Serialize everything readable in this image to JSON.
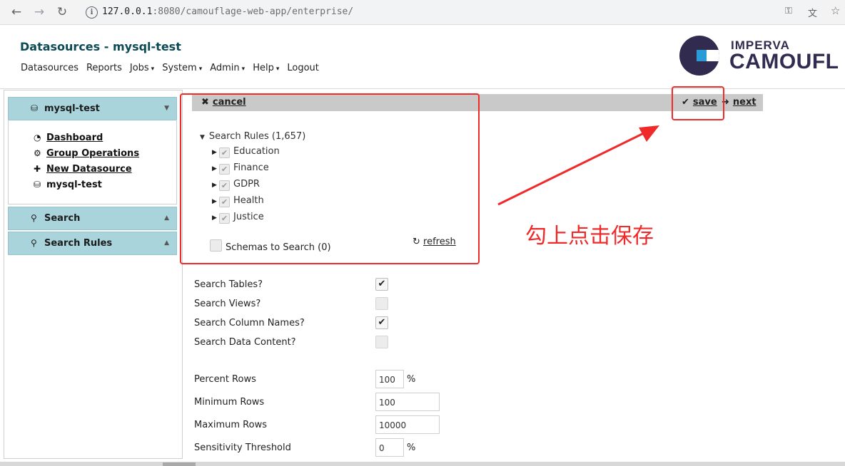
{
  "browser": {
    "url_host": "127.0.0.1",
    "url_rest": ":8080/camouflage-web-app/enterprise/",
    "back_glyph": "←",
    "forward_glyph": "→",
    "reload_glyph": "↻",
    "info_glyph": "i",
    "key_glyph": "⚿",
    "translate_glyph": "文",
    "star_glyph": "☆"
  },
  "header": {
    "title": "Datasources - mysql-test",
    "nav": [
      {
        "label": "Datasources",
        "caret": ""
      },
      {
        "label": "Reports",
        "caret": ""
      },
      {
        "label": "Jobs",
        "caret": "▾"
      },
      {
        "label": "System",
        "caret": "▾"
      },
      {
        "label": "Admin",
        "caret": "▾"
      },
      {
        "label": "Help",
        "caret": "▾"
      },
      {
        "label": "Logout",
        "caret": ""
      }
    ],
    "logo_line1": "IMPERVA",
    "logo_line2": "CAMOUFL"
  },
  "sidebar": {
    "panel_main": {
      "label": "mysql-test",
      "icon": "⛁",
      "arrow": "▼"
    },
    "items": [
      {
        "label": "Dashboard",
        "icon": "◔"
      },
      {
        "label": "Group Operations",
        "icon": "⚙"
      },
      {
        "label": "New Datasource",
        "icon": "✚"
      },
      {
        "label": "mysql-test",
        "icon": "⛁"
      }
    ],
    "panel_search": {
      "label": "Search",
      "icon": "⚲",
      "arrow": "▲"
    },
    "panel_search_rules": {
      "label": "Search Rules",
      "icon": "⚲",
      "arrow": "▲"
    }
  },
  "toolbar": {
    "cancel": {
      "label": "cancel",
      "icon": "✖"
    },
    "save": {
      "label": "save",
      "icon": "✔"
    },
    "next": {
      "label": "next",
      "icon": "➜"
    }
  },
  "tree": {
    "root_label": "Search Rules (1,657)",
    "root_tri": "▼",
    "item_tri": "▶",
    "check_glyph": "✔",
    "items": [
      {
        "label": "Education"
      },
      {
        "label": "Finance"
      },
      {
        "label": "GDPR"
      },
      {
        "label": "Health"
      },
      {
        "label": "Justice"
      }
    ],
    "schemas_label": "Schemas to Search (0)",
    "refresh_label": "refresh",
    "refresh_icon": "↻"
  },
  "annotation": "勾上点击保存",
  "form": {
    "check_glyph": "✔",
    "checks": [
      {
        "label": "Search Tables?",
        "checked": true
      },
      {
        "label": "Search Views?",
        "checked": false
      },
      {
        "label": "Search Column Names?",
        "checked": true
      },
      {
        "label": "Search Data Content?",
        "checked": false
      }
    ],
    "fields": [
      {
        "label": "Percent Rows",
        "value": "100",
        "unit": "%"
      },
      {
        "label": "Minimum Rows",
        "value": "100",
        "unit": ""
      },
      {
        "label": "Maximum Rows",
        "value": "10000",
        "unit": ""
      },
      {
        "label": "Sensitivity Threshold",
        "value": "0",
        "unit": "%"
      }
    ]
  },
  "colors": {
    "accent_teal": "#0b4a55",
    "panel_teal": "#a9d4dc",
    "annotation_red": "#ef2a2a",
    "logo_navy": "#302b4f",
    "logo_blue": "#2a9bd6"
  }
}
